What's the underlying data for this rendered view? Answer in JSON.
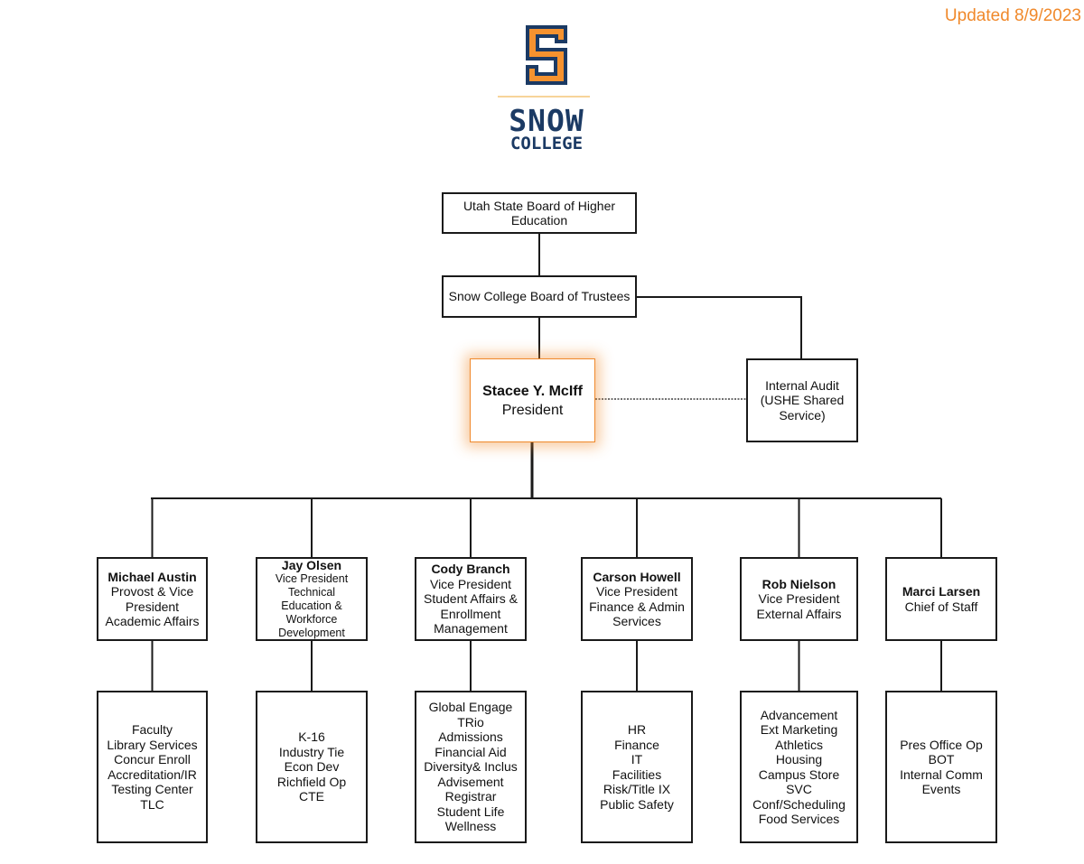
{
  "updated": "Updated 8/9/2023",
  "logo": {
    "line1": "SNOW",
    "line2": "COLLEGE",
    "colors": {
      "orange": "#f5922f",
      "navy": "#1b3a64"
    }
  },
  "board": "Utah State Board of Higher Education",
  "trustees": "Snow College Board of Trustees",
  "president": {
    "name": "Stacee Y. McIff",
    "title": "President"
  },
  "audit": "Internal Audit (USHE Shared Service)",
  "accent": "#f0892b",
  "vps": [
    {
      "name": "Michael Austin",
      "title": "Provost & Vice President Academic Affairs",
      "units": [
        "Faculty",
        "Library Services",
        "Concur Enroll",
        "Accreditation/IR",
        "Testing Center",
        "TLC"
      ]
    },
    {
      "name": "Jay Olsen",
      "title": "Vice President Technical Education & Workforce Development",
      "units": [
        "K-16",
        "Industry Tie",
        "Econ Dev",
        "Richfield Op",
        "CTE"
      ]
    },
    {
      "name": "Cody Branch",
      "title": "Vice President Student Affairs & Enrollment Management",
      "units": [
        "Global Engage",
        "TRio",
        "Admissions",
        "Financial Aid",
        "Diversity& Inclus",
        "Advisement",
        "Registrar",
        "Student Life",
        "Wellness"
      ]
    },
    {
      "name": "Carson Howell",
      "title": "Vice President Finance & Admin Services",
      "units": [
        "HR",
        "Finance",
        "IT",
        "Facilities",
        "Risk/Title IX",
        "Public Safety"
      ]
    },
    {
      "name": "Rob Nielson",
      "title": "Vice President External Affairs",
      "units": [
        "Advancement",
        "Ext Marketing",
        "Athletics",
        "Housing",
        "Campus Store",
        "SVC",
        "Conf/Scheduling",
        "Food Services"
      ]
    },
    {
      "name": "Marci Larsen",
      "title": "Chief of Staff",
      "units": [
        "Pres Office Op",
        "BOT",
        "Internal Comm",
        "Events"
      ]
    }
  ]
}
